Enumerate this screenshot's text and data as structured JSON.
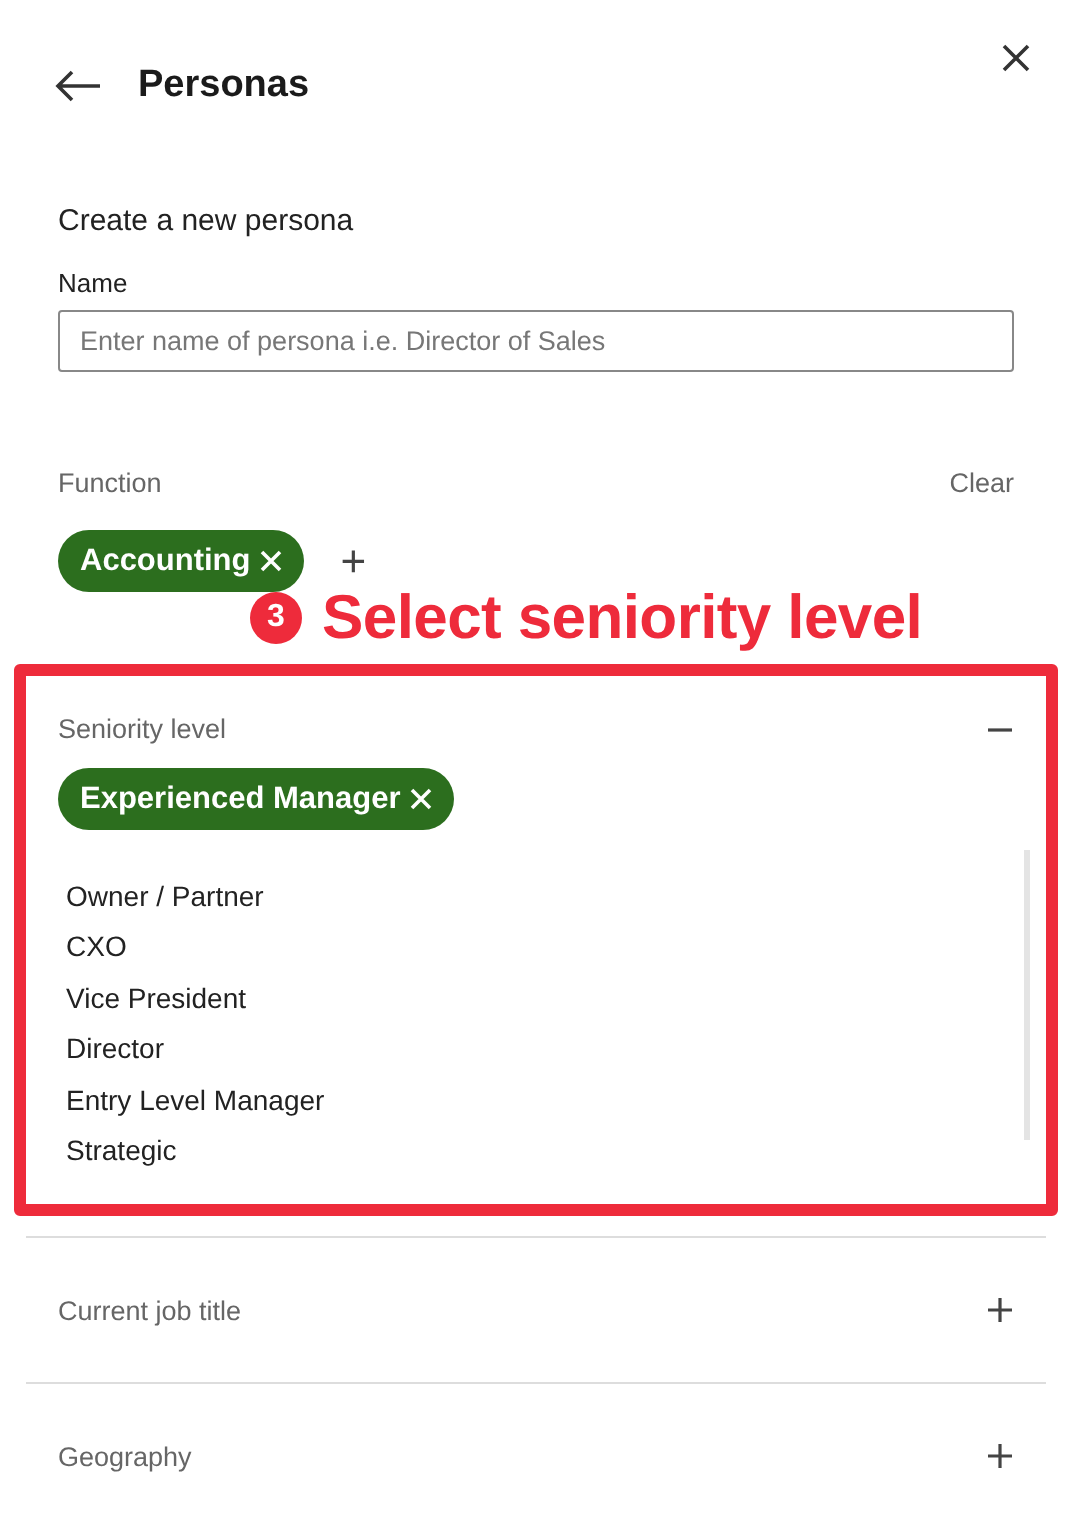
{
  "header": {
    "title": "Personas"
  },
  "form": {
    "heading": "Create a new persona",
    "name_label": "Name",
    "name_placeholder": "Enter name of persona i.e. Director of Sales"
  },
  "function": {
    "label": "Function",
    "clear": "Clear",
    "chips": [
      "Accounting"
    ],
    "add": "+"
  },
  "callout": {
    "step": "3",
    "text": "Select seniority level"
  },
  "seniority": {
    "label": "Seniority level",
    "expanded": true,
    "highlighted": true,
    "chips": [
      "Experienced Manager"
    ],
    "options": [
      "Owner / Partner",
      "CXO",
      "Vice President",
      "Director",
      "Entry Level Manager",
      "Strategic"
    ]
  },
  "sections": [
    {
      "label": "Current job title",
      "expanded": false
    },
    {
      "label": "Geography",
      "expanded": false
    }
  ]
}
